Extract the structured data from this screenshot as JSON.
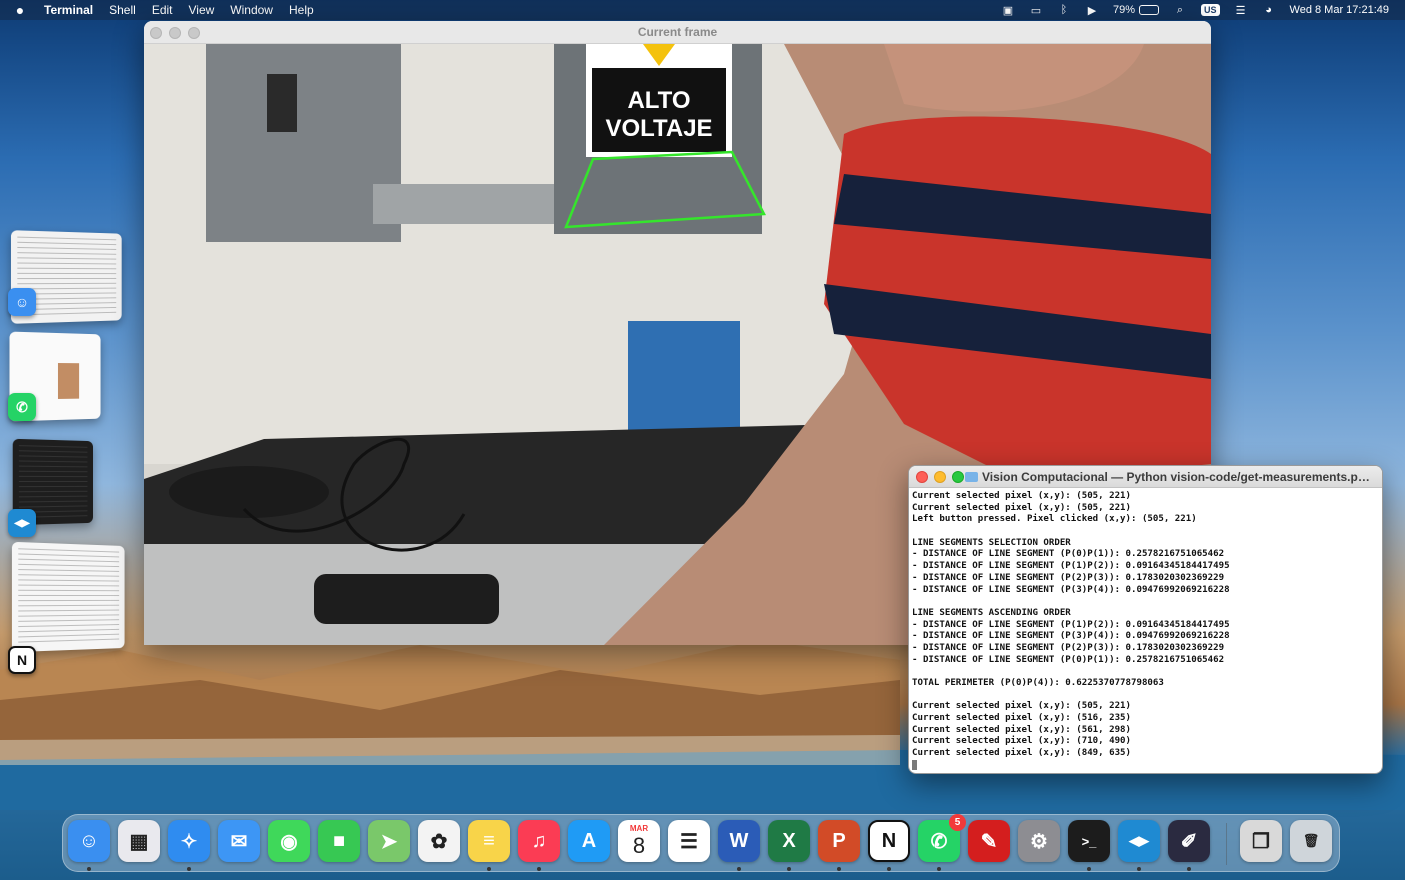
{
  "menubar": {
    "app_name": "Terminal",
    "menus": [
      "Shell",
      "Edit",
      "View",
      "Window",
      "Help"
    ],
    "battery_percent": "79%",
    "battery_level": 0.79,
    "input_source": "US",
    "clock": "Wed 8 Mar  17:21:49"
  },
  "camera_window": {
    "title": "Current frame",
    "sign_text_line1": "ALTO",
    "sign_text_line2": "VOLTAJE"
  },
  "terminal": {
    "title": "Vision Computacional — Python vision-code/get-measurements.py --ca...",
    "lines": [
      "Current selected pixel (x,y): (505, 221)",
      "Current selected pixel (x,y): (505, 221)",
      "Left button pressed. Pixel clicked (x,y): (505, 221)",
      "",
      "LINE SEGMENTS SELECTION ORDER",
      "- DISTANCE OF LINE SEGMENT (P(0)P(1)): 0.2578216751065462",
      "- DISTANCE OF LINE SEGMENT (P(1)P(2)): 0.09164345184417495",
      "- DISTANCE OF LINE SEGMENT (P(2)P(3)): 0.1783020302369229",
      "- DISTANCE OF LINE SEGMENT (P(3)P(4)): 0.09476992069216228",
      "",
      "LINE SEGMENTS ASCENDING ORDER",
      "- DISTANCE OF LINE SEGMENT (P(1)P(2)): 0.09164345184417495",
      "- DISTANCE OF LINE SEGMENT (P(3)P(4)): 0.09476992069216228",
      "- DISTANCE OF LINE SEGMENT (P(2)P(3)): 0.1783020302369229",
      "- DISTANCE OF LINE SEGMENT (P(0)P(1)): 0.2578216751065462",
      "",
      "TOTAL PERIMETER (P(0)P(4)): 0.6225370778798063",
      "",
      "Current selected pixel (x,y): (505, 221)",
      "Current selected pixel (x,y): (516, 235)",
      "Current selected pixel (x,y): (561, 298)",
      "Current selected pixel (x,y): (710, 490)",
      "Current selected pixel (x,y): (849, 635)"
    ]
  },
  "stage_manager": [
    {
      "app": "Finder"
    },
    {
      "app": "WhatsApp"
    },
    {
      "app": "Visual Studio Code"
    },
    {
      "app": "Notion"
    }
  ],
  "dock": {
    "calendar_month": "MAR",
    "calendar_day": "8",
    "whatsapp_badge": "5",
    "items": [
      {
        "icon": "finder-icon",
        "color": "#3a8ff0",
        "glyph": "☺"
      },
      {
        "icon": "launchpad-icon",
        "color": "#e9e9ee",
        "glyph": "▦"
      },
      {
        "icon": "safari-icon",
        "color": "#2f8cf0",
        "glyph": "✧"
      },
      {
        "icon": "mail-icon",
        "color": "#3d96f5",
        "glyph": "✉"
      },
      {
        "icon": "messages-icon",
        "color": "#3fd85a",
        "glyph": "◉"
      },
      {
        "icon": "facetime-icon",
        "color": "#37c853",
        "glyph": "■"
      },
      {
        "icon": "maps-icon",
        "color": "#7ac86a",
        "glyph": "➤"
      },
      {
        "icon": "photos-icon",
        "color": "#f3f3f3",
        "glyph": "✿"
      },
      {
        "icon": "notes-icon",
        "color": "#f8d449",
        "glyph": "≡"
      },
      {
        "icon": "music-icon",
        "color": "#fb3c54",
        "glyph": "♫"
      },
      {
        "icon": "app-store-icon",
        "color": "#1f9bf5",
        "glyph": "A"
      },
      {
        "icon": "calendar-icon",
        "color": "#ffffff",
        "glyph": ""
      },
      {
        "icon": "reminders-icon",
        "color": "#ffffff",
        "glyph": "☰"
      },
      {
        "icon": "word-icon",
        "color": "#2b5cb7",
        "glyph": "W"
      },
      {
        "icon": "excel-icon",
        "color": "#1f7a45",
        "glyph": "X"
      },
      {
        "icon": "powerpoint-icon",
        "color": "#d24b27",
        "glyph": "P"
      },
      {
        "icon": "notion-icon",
        "color": "#ffffff",
        "glyph": "N"
      },
      {
        "icon": "whatsapp-icon",
        "color": "#25d366",
        "glyph": "✆"
      },
      {
        "icon": "acrobat-icon",
        "color": "#d41e1e",
        "glyph": "✎"
      },
      {
        "icon": "system-settings-icon",
        "color": "#8d8d92",
        "glyph": "⚙"
      },
      {
        "icon": "terminal-icon",
        "color": "#1c1c1c",
        "glyph": ">_"
      },
      {
        "icon": "vscode-icon",
        "color": "#1f8ad2",
        "glyph": "◀▶"
      },
      {
        "icon": "pencil-app-icon",
        "color": "#2a2a40",
        "glyph": "✐"
      },
      {
        "icon": "documents-folder-icon",
        "color": "#d9d9d9",
        "glyph": "❐"
      },
      {
        "icon": "trash-icon",
        "color": "#cfd5da",
        "glyph": "🗑"
      }
    ]
  }
}
